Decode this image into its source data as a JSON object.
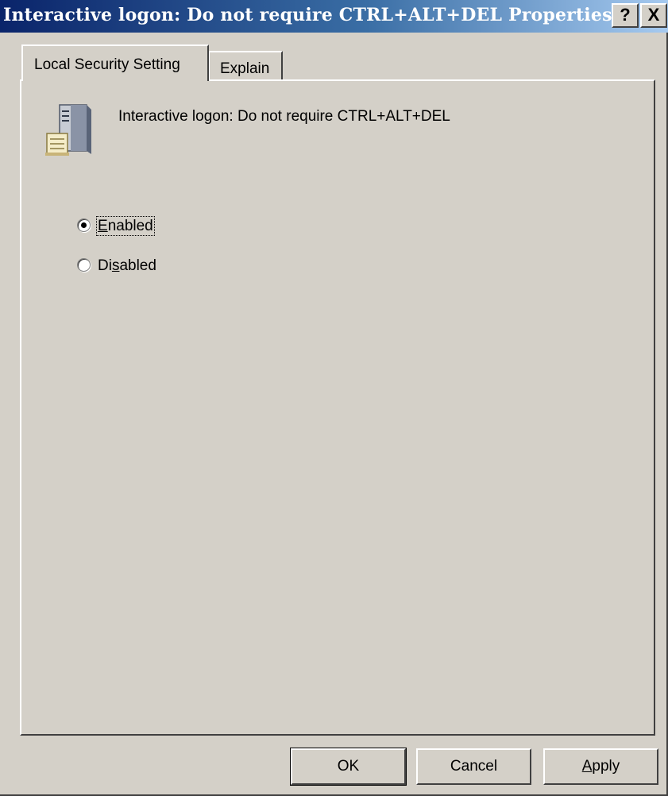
{
  "window": {
    "title": "Interactive logon: Do not require CTRL+ALT+DEL Properties",
    "help_label": "?",
    "close_label": "X"
  },
  "tabs": [
    {
      "label": "Local Security Setting",
      "active": true
    },
    {
      "label": "Explain",
      "active": false
    }
  ],
  "policy": {
    "title": "Interactive logon: Do not require CTRL+ALT+DEL",
    "icon": "server-policy-icon"
  },
  "options": {
    "enabled": {
      "label_pre": "",
      "accesskey": "E",
      "label_post": "nabled",
      "checked": true
    },
    "disabled": {
      "label_pre": "Di",
      "accesskey": "s",
      "label_post": "abled",
      "checked": false
    }
  },
  "buttons": {
    "ok": "OK",
    "cancel": "Cancel",
    "apply_accesskey": "A",
    "apply_rest": "pply"
  }
}
